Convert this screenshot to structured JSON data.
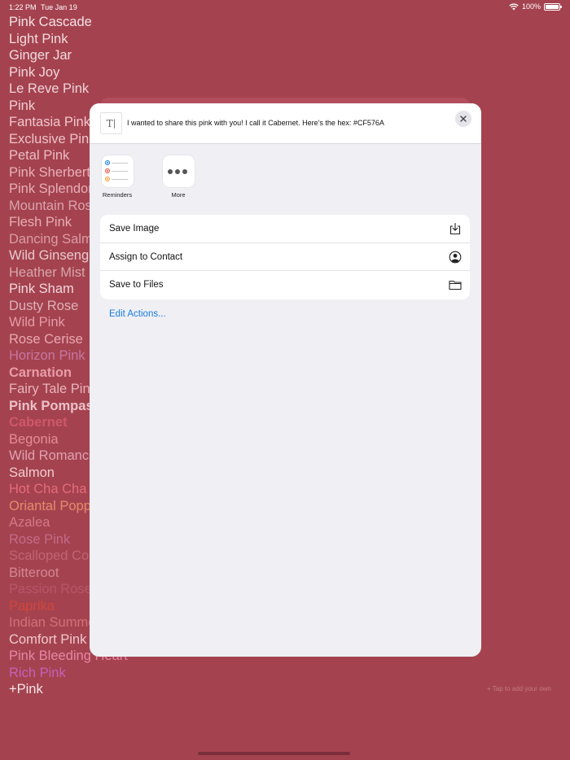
{
  "status_bar": {
    "time": "1:22 PM",
    "date": "Tue Jan 19",
    "battery": "100%"
  },
  "color_list": [
    {
      "name": "Pink Cascade",
      "color": "#f5e3e6",
      "bold": false
    },
    {
      "name": "Light Pink",
      "color": "#f3dadd",
      "bold": false
    },
    {
      "name": "Ginger Jar",
      "color": "#f1dbdf",
      "bold": false
    },
    {
      "name": "Pink Joy",
      "color": "#f2d8dc",
      "bold": false
    },
    {
      "name": "Le Reve Pink",
      "color": "#efd3d8",
      "bold": false
    },
    {
      "name": "Pink",
      "color": "#f2cdd3",
      "bold": false
    },
    {
      "name": "Fantasia Pink",
      "color": "#f0c6cd",
      "bold": false
    },
    {
      "name": "Exclusive Pink",
      "color": "#eec2c9",
      "bold": false
    },
    {
      "name": "Petal Pink",
      "color": "#ecbcc4",
      "bold": false
    },
    {
      "name": "Pink Sherbert",
      "color": "#e8b0ba",
      "bold": false
    },
    {
      "name": "Pink Splendor",
      "color": "#e6adb7",
      "bold": false
    },
    {
      "name": "Mountain Rose",
      "color": "#d9a3ad",
      "bold": false
    },
    {
      "name": "Flesh Pink",
      "color": "#e6adb4",
      "bold": false
    },
    {
      "name": "Dancing Salmon",
      "color": "#d99ca5",
      "bold": false
    },
    {
      "name": "Wild Ginseng",
      "color": "#e8c9ce",
      "bold": false
    },
    {
      "name": "Heather Mist",
      "color": "#d6a5ad",
      "bold": false
    },
    {
      "name": "Pink Sham",
      "color": "#f1d6da",
      "bold": false
    },
    {
      "name": "Dusty Rose",
      "color": "#ddb1b8",
      "bold": false
    },
    {
      "name": "Wild Pink",
      "color": "#e79aa8",
      "bold": false
    },
    {
      "name": "Rose Cerise",
      "color": "#e9a8b2",
      "bold": false
    },
    {
      "name": "Horizon Pink",
      "color": "#c776a1",
      "bold": false
    },
    {
      "name": "Carnation",
      "color": "#e99ba8",
      "bold": true
    },
    {
      "name": "Fairy Tale Pink",
      "color": "#e8b3bc",
      "bold": false
    },
    {
      "name": "Pink Pompas",
      "color": "#ecc0c7",
      "bold": true
    },
    {
      "name": "Cabernet",
      "color": "#cf576a",
      "bold": true
    },
    {
      "name": "Begonia",
      "color": "#e68a98",
      "bold": false
    },
    {
      "name": "Wild Romance",
      "color": "#e0a1b1",
      "bold": false
    },
    {
      "name": "Salmon",
      "color": "#f2cbcf",
      "bold": false
    },
    {
      "name": "Hot Cha Cha",
      "color": "#e56b7a",
      "bold": false
    },
    {
      "name": "Oriantal Poppy",
      "color": "#e68a6c",
      "bold": false
    },
    {
      "name": "Azalea",
      "color": "#d37788",
      "bold": false
    },
    {
      "name": "Rose Pink",
      "color": "#c46a8a",
      "bold": false
    },
    {
      "name": "Scalloped Coral",
      "color": "#c06375",
      "bold": false
    },
    {
      "name": "Bitteroot",
      "color": "#d68596",
      "bold": false
    },
    {
      "name": "Passion Rose",
      "color": "#b6566b",
      "bold": false
    },
    {
      "name": "Paprika",
      "color": "#d0463d",
      "bold": false
    },
    {
      "name": "Indian Summer",
      "color": "#d46f78",
      "bold": false
    },
    {
      "name": "Comfort Pink",
      "color": "#efc8cd",
      "bold": false
    },
    {
      "name": "Pink Bleeding Heart",
      "color": "#e786a6",
      "bold": false
    },
    {
      "name": "Rich Pink",
      "color": "#c85fba",
      "bold": false
    },
    {
      "name": "+Pink",
      "color": "#f4e5e8",
      "bold": false
    }
  ],
  "share_sheet": {
    "share_text": "I wanted to share this pink with you! I call it Cabernet. Here's the hex: #CF576A",
    "apps": [
      {
        "label": "Reminders",
        "icon": "reminders-icon"
      },
      {
        "label": "More",
        "icon": "more-icon"
      }
    ],
    "actions": [
      {
        "label": "Save Image",
        "icon": "save-image-icon"
      },
      {
        "label": "Assign to Contact",
        "icon": "contact-icon"
      },
      {
        "label": "Save to Files",
        "icon": "folder-icon"
      }
    ],
    "edit_actions_label": "Edit Actions..."
  },
  "tap_hint": "+ Tap to add your own"
}
